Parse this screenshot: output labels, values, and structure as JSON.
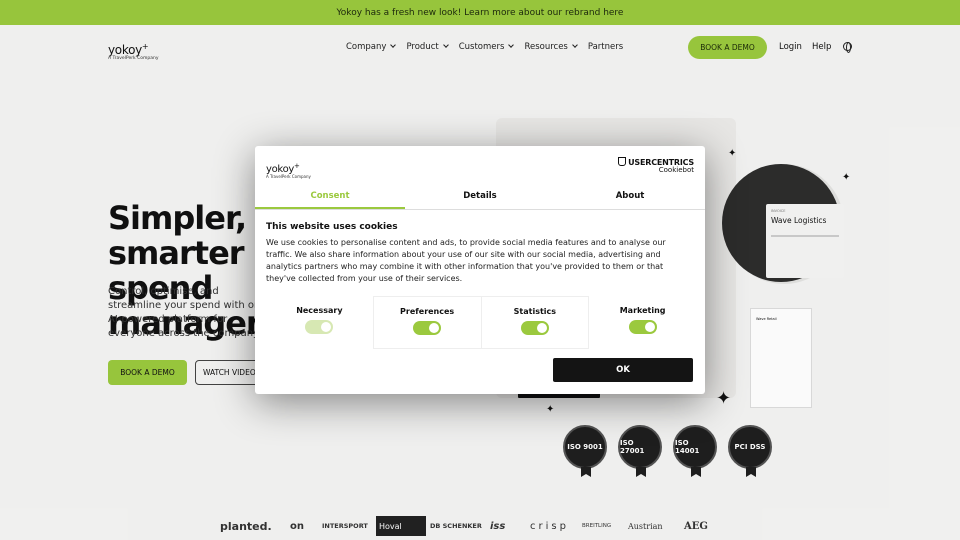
{
  "banner": {
    "text": "Yokoy has a fresh new look! Learn more about our rebrand here"
  },
  "nav": {
    "logo_word": "yokoy",
    "logo_sup": "+",
    "logo_sub": "A TravelPerk Company",
    "links": [
      "Company",
      "Product",
      "Customers",
      "Resources",
      "Partners"
    ],
    "book_demo": "BOOK A DEMO",
    "login": "Login",
    "help": "Help"
  },
  "hero": {
    "title": "Simpler, smarter spend management",
    "subtitle": "Control, optimise, and streamline your spend with one AI-powered platform for everyone across the company.",
    "book_demo": "BOOK A DEMO",
    "watch_video": "WATCH VIDEO"
  },
  "mock": {
    "card_small": "INVOICE",
    "card_title": "Wave Logistics",
    "doc_title": "Wave Retail"
  },
  "badges": [
    "ISO 9001",
    "ISO 27001",
    "ISO 14001",
    "PCI DSS"
  ],
  "brands": [
    "planted.",
    "on",
    "INTERSPORT",
    "Hoval",
    "DB SCHENKER",
    "iss",
    "crisp",
    "BREITLING",
    "Austrian",
    "AEG"
  ],
  "consent": {
    "logo_word": "yokoy",
    "logo_sup": "+",
    "logo_sub": "A TravelPerk Company",
    "provider": "USERCENTRICS",
    "provider_sub": "Cookiebot",
    "tabs": [
      "Consent",
      "Details",
      "About"
    ],
    "title": "This website uses cookies",
    "body": "We use cookies to personalise content and ads, to provide social media features and to analyse our traffic. We also share information about your use of our site with our social media, advertising and analytics partners who may combine it with other information that you've provided to them or that they've collected from your use of their services.",
    "toggles": [
      {
        "label": "Necessary",
        "on": true,
        "disabled": true
      },
      {
        "label": "Preferences",
        "on": true
      },
      {
        "label": "Statistics",
        "on": true
      },
      {
        "label": "Marketing",
        "on": true
      }
    ],
    "ok": "OK"
  }
}
